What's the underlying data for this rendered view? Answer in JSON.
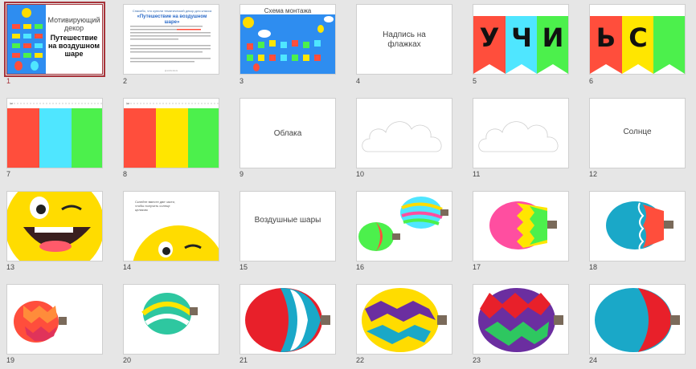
{
  "slides": [
    {
      "number": "1",
      "title": "Мотивирующий декор",
      "subtitle": "Путешествие на воздушном шаре"
    },
    {
      "number": "2",
      "heading": "Спасибо, что купили тематический декор для класса",
      "title": "«Путешествие на воздушном шаре»",
      "footer": "@skills4kids"
    },
    {
      "number": "3",
      "title": "Схема монтажа"
    },
    {
      "number": "4",
      "title": "Надпись на флажках"
    },
    {
      "number": "5",
      "letters": [
        "У",
        "Ч",
        "И"
      ]
    },
    {
      "number": "6",
      "letters": [
        "Ь",
        "С",
        ""
      ]
    },
    {
      "number": "7"
    },
    {
      "number": "8"
    },
    {
      "number": "9",
      "title": "Облака"
    },
    {
      "number": "10"
    },
    {
      "number": "11"
    },
    {
      "number": "12",
      "title": "Солнце"
    },
    {
      "number": "13"
    },
    {
      "number": "14",
      "note": "Склейте вместе две части, чтобы получить солнце целиком"
    },
    {
      "number": "15",
      "title": "Воздушные шары"
    },
    {
      "number": "16"
    },
    {
      "number": "17"
    },
    {
      "number": "18"
    },
    {
      "number": "19"
    },
    {
      "number": "20"
    },
    {
      "number": "21"
    },
    {
      "number": "22"
    },
    {
      "number": "23"
    },
    {
      "number": "24"
    }
  ],
  "colors": {
    "selection": "#a7333a",
    "flag_red": "#ff4e3c",
    "flag_cyan": "#4fe6ff",
    "flag_green": "#4cf04c",
    "flag_yellow": "#ffe600",
    "blue_panel": "#2e8df0",
    "sun_yellow": "#ffdc00"
  }
}
